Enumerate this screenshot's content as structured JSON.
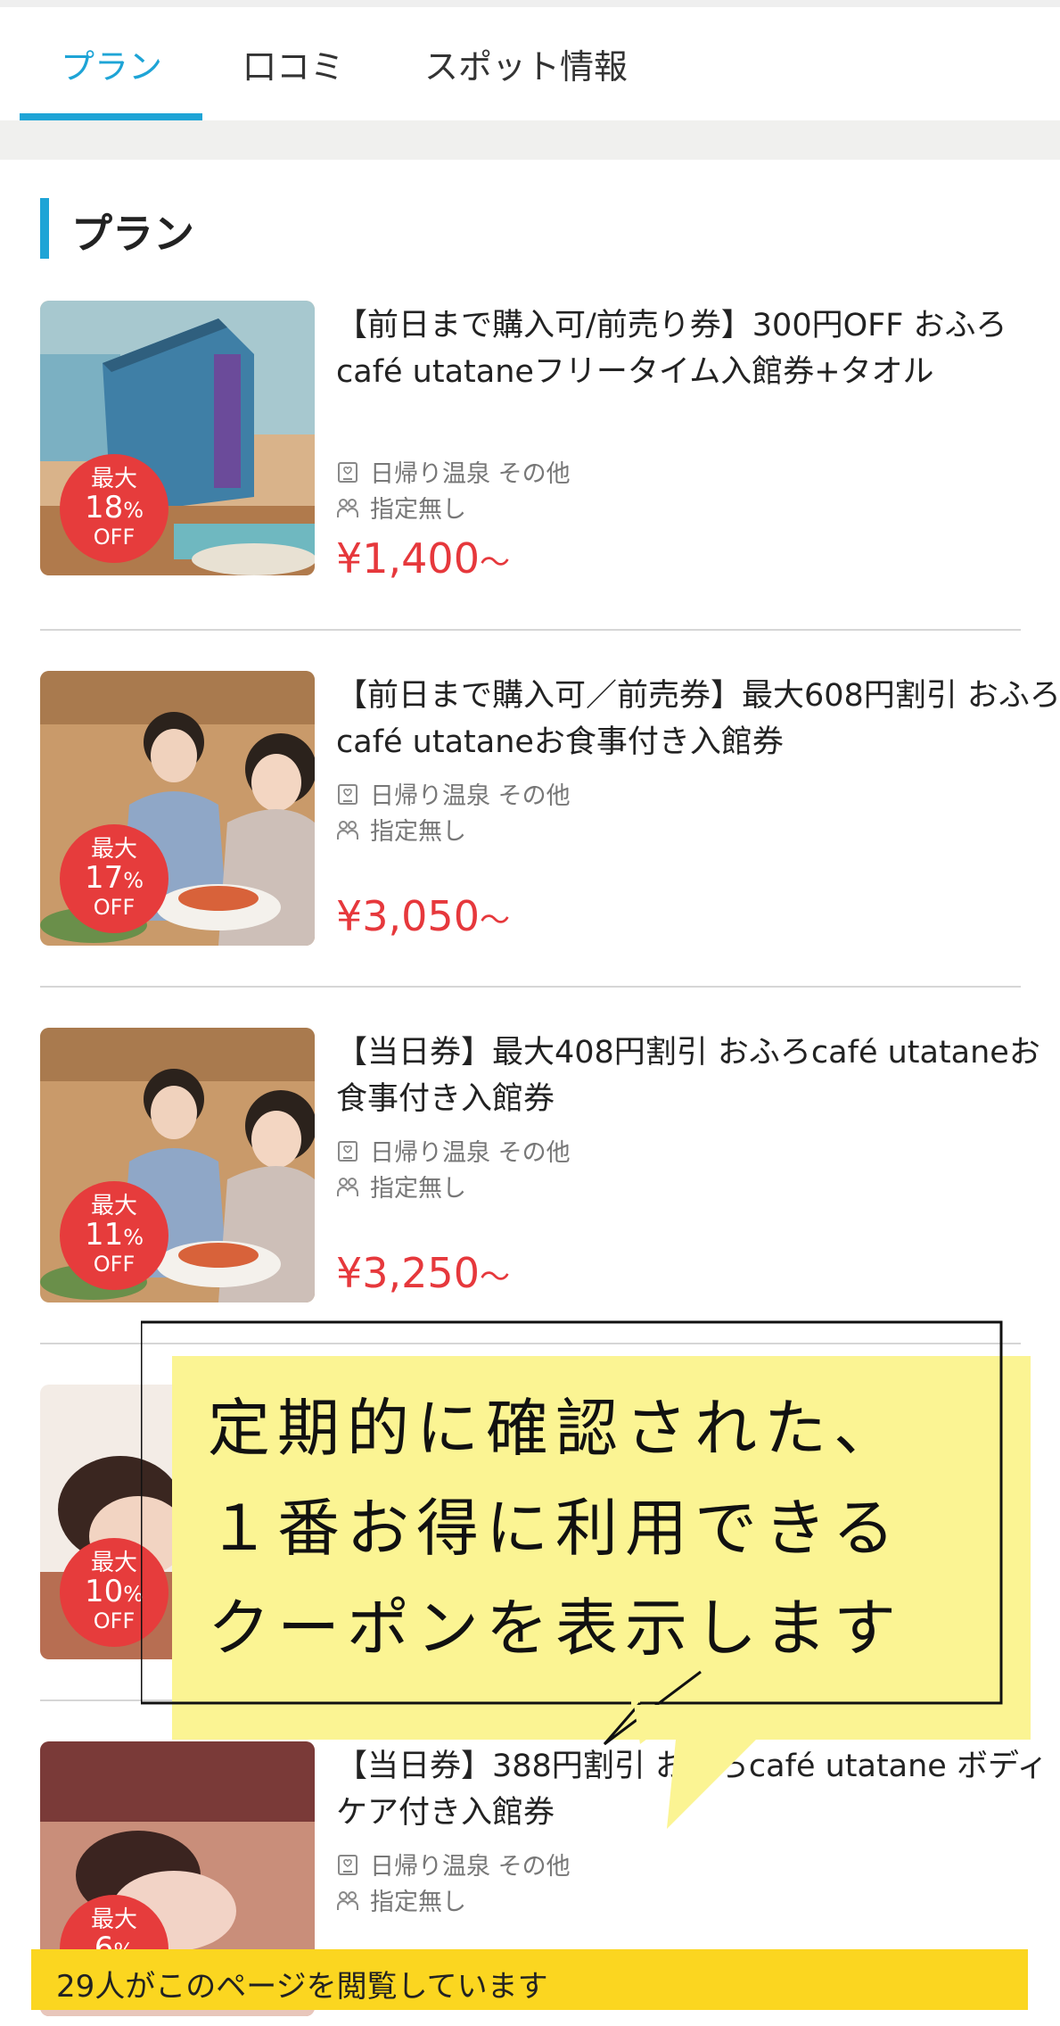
{
  "tabs": [
    {
      "label": "プラン",
      "active": true
    },
    {
      "label": "口コミ",
      "active": false
    },
    {
      "label": "スポット情報",
      "active": false
    }
  ],
  "section_title": "プラン",
  "plans": [
    {
      "title": "【前日まで購入可/前売り券】300円OFF おふろcafé utataneフリータイム入館券+タオル",
      "category": "日帰り温泉 その他",
      "people": "指定無し",
      "price": "¥1,400",
      "price_suffix": "〜",
      "badge_top": "最大",
      "badge_value": "18",
      "badge_unit": "%",
      "badge_off": "OFF"
    },
    {
      "title": "【前日まで購入可／前売券】最大608円割引 おふろcafé utataneお食事付き入館券",
      "category": "日帰り温泉 その他",
      "people": "指定無し",
      "price": "¥3,050",
      "price_suffix": "〜",
      "badge_top": "最大",
      "badge_value": "17",
      "badge_unit": "%",
      "badge_off": "OFF"
    },
    {
      "title": "【当日券】最大408円割引 おふろcafé utataneお食事付き入館券",
      "category": "日帰り温泉 その他",
      "people": "指定無し",
      "price": "¥3,250",
      "price_suffix": "〜",
      "badge_top": "最大",
      "badge_value": "11",
      "badge_unit": "%",
      "badge_off": "OFF"
    },
    {
      "badge_top": "最大",
      "badge_value": "10",
      "badge_unit": "%",
      "badge_off": "OFF"
    },
    {
      "title": "【当日券】388円割引 おふろcafé utatane ボディケア付き入館券",
      "category": "日帰り温泉 その他",
      "people": "指定無し",
      "badge_top": "最大",
      "badge_value": "6",
      "badge_unit": "%"
    }
  ],
  "callout": {
    "line1": "定期的に確認された、",
    "line2": "１番お得に利用できる",
    "line3": "クーポンを表示します"
  },
  "viewers_text": "29人がこのページを閲覧しています",
  "colors": {
    "accent": "#1ea4d6",
    "price": "#e6383c",
    "badge": "#e63c3c",
    "callout": "#fbf493",
    "view_bar": "#fbd620"
  }
}
